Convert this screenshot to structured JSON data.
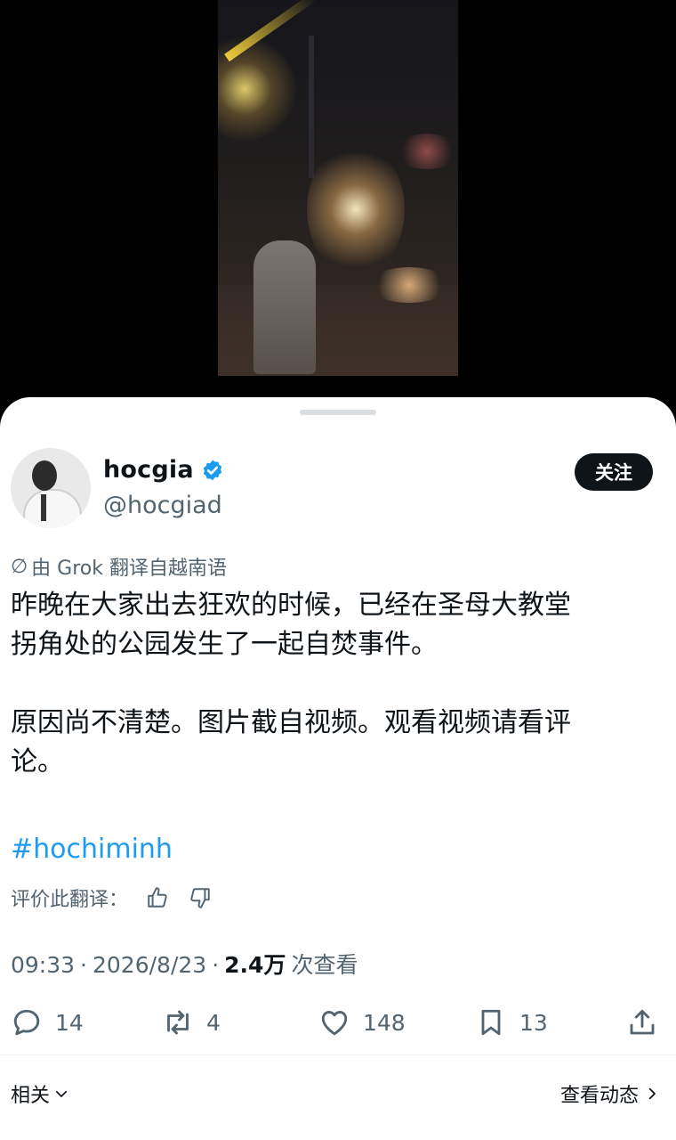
{
  "media": {
    "description_icon": "video-thumbnail"
  },
  "user": {
    "display_name": "hocgia",
    "handle": "@hocgiad",
    "verified_icon": "verified-badge-icon",
    "follow_label": "关注"
  },
  "translation": {
    "label": "由 Grok 翻译自越南语"
  },
  "tweet": {
    "line1": "昨晚在大家出去狂欢的时候，已经在圣母大教堂",
    "line2": "拐角处的公园发生了一起自焚事件。",
    "line3": "原因尚不清楚。图片截自视频。观看视频请看评",
    "line4": "论。",
    "hashtag": "#hochiminh"
  },
  "rating": {
    "label": "评价此翻译："
  },
  "meta": {
    "time": "09:33",
    "date": "2026/8/23",
    "views": "2.4万",
    "views_suffix": "次查看",
    "sep": "·"
  },
  "actions": {
    "reply_count": "14",
    "repost_count": "4",
    "like_count": "148",
    "bookmark_count": "13"
  },
  "footer": {
    "related_label": "相关",
    "view_activity_label": "查看动态"
  },
  "colors": {
    "accent": "#1d9bf0",
    "text": "#0f1419",
    "secondary": "#536471"
  }
}
